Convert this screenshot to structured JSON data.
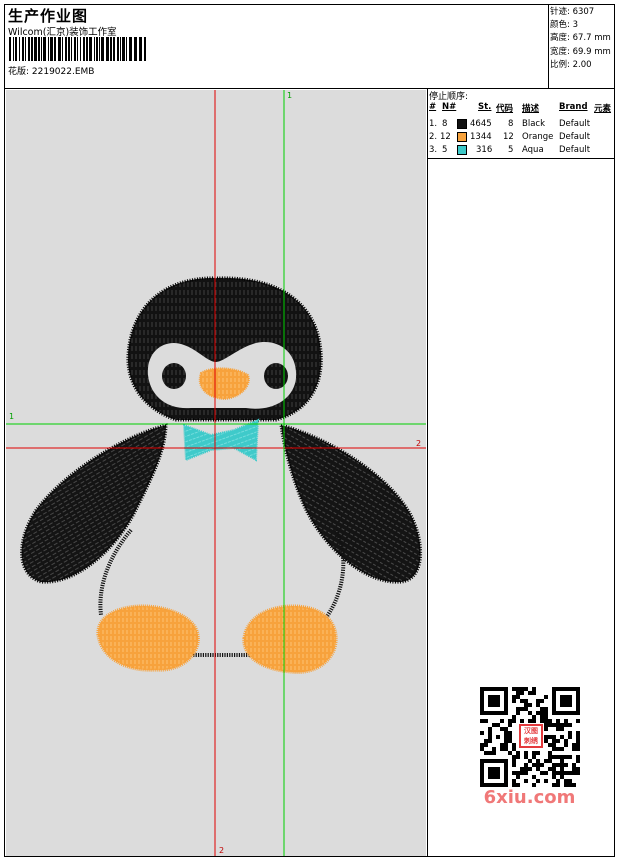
{
  "header": {
    "title": "生产作业图",
    "studio": "Wilcom(汇京)装饰工作室",
    "filename": "花版: 2219022.EMB"
  },
  "stats": [
    {
      "label": "针迹:",
      "value": "6307"
    },
    {
      "label": "颜色:",
      "value": "3"
    },
    {
      "label": "高度:",
      "value": "67.7 mm"
    },
    {
      "label": "宽度:",
      "value": "69.9 mm"
    },
    {
      "label": "比例:",
      "value": "2.00"
    }
  ],
  "stop_sequence": {
    "title": "停止顺序:",
    "columns": [
      "#",
      "N#",
      "St.",
      "代码",
      "描述",
      "Brand",
      "元素"
    ],
    "rows": [
      {
        "num": "1.",
        "n": "8",
        "color": "#111111",
        "stitches": "4645",
        "code": "8",
        "desc": "Black",
        "brand": "Default"
      },
      {
        "num": "2.",
        "n": "12",
        "color": "#f7a23c",
        "stitches": "1344",
        "code": "12",
        "desc": "Orange",
        "brand": "Default"
      },
      {
        "num": "3.",
        "n": "5",
        "color": "#3cc8c8",
        "stitches": "316",
        "code": "5",
        "desc": "Aqua",
        "brand": "Default"
      }
    ]
  },
  "canvas": {
    "background": "#dcdcdc",
    "axis_red_color": "#e00000",
    "axis_green_color": "#00d000",
    "red_h_label": "2",
    "red_v_label": "2",
    "green_h_label": "1",
    "green_v_label": "1"
  },
  "qr": {
    "seal_text": "汉图刺绣",
    "brand_text": "6xiu.com"
  }
}
